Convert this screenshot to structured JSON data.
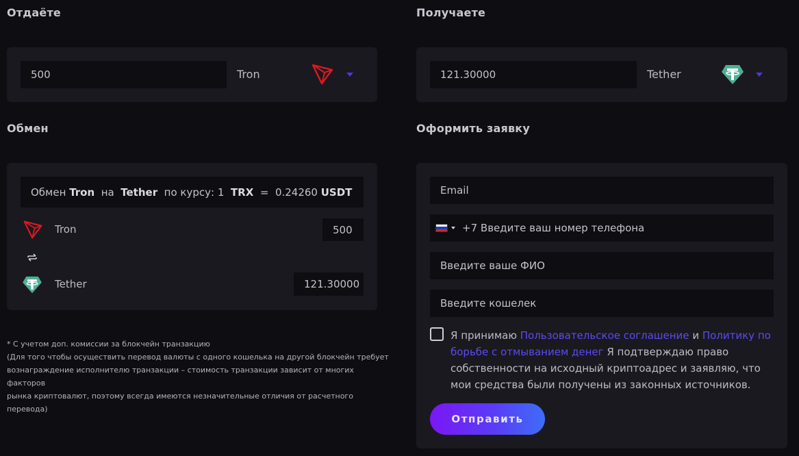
{
  "give": {
    "heading": "Отдаёте",
    "amount": "500",
    "currency": "Tron",
    "icon": "tron-icon"
  },
  "receive": {
    "heading": "Получаете",
    "amount": "121.30000",
    "currency": "Tether",
    "icon": "tether-icon"
  },
  "exchange": {
    "heading": "Обмен",
    "rate": {
      "prefix": "Обмен",
      "from": "Tron",
      "on": "на",
      "to": "Tether",
      "by_rate": "по курсу: 1",
      "from_code": "TRX",
      "equals": "=",
      "value": "0.24260",
      "to_code": "USDT"
    },
    "from_label": "Tron",
    "from_amount": "500",
    "to_label": "Tether",
    "to_amount": "121.30000"
  },
  "note": {
    "line1": "* С учетом доп. комиссии за блокчейн транзакцию",
    "line2": "(Для того чтобы осуществить перевод валюты с одного кошелька на другой блокчейн требует",
    "line3": "вознаграждение исполнителю транзакции – стоимость транзакции зависит от многих факторов",
    "line4": "рынка криптовалют, поэтому всегда имеются незначительные отличия от расчетного перевода)"
  },
  "order": {
    "heading": "Оформить заявку",
    "email_placeholder": "Email",
    "phone_code": "+7",
    "phone_placeholder": "Введите ваш номер телефона",
    "name_placeholder": "Введите ваше ФИО",
    "wallet_placeholder": "Введите кошелек",
    "consent_prefix": "Я принимаю",
    "consent_link1": "Пользовательское соглашение",
    "consent_and": "и",
    "consent_link2": "Политику по борьбе с отмыванием денег",
    "consent_suffix": "Я подтверждаю право собственности на исходный криптоадрес и заявляю, что мои средства были получены из законных источников.",
    "submit_label": "Отправить"
  },
  "colors": {
    "background": "#0e0d12",
    "panel": "#1a1920",
    "accent": "#5b4bf0",
    "tron": "#e0171f",
    "tether": "#50af95"
  }
}
